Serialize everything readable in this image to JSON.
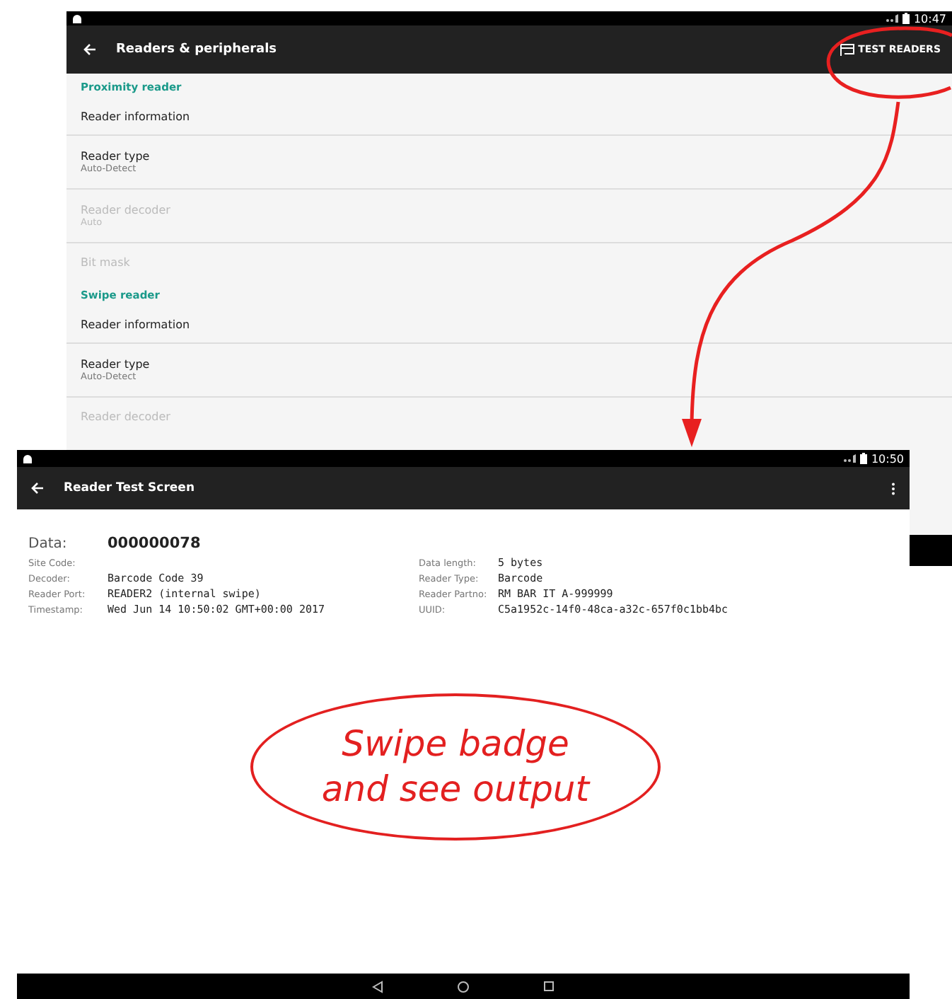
{
  "settings_screen": {
    "status_bar": {
      "time": "10:47"
    },
    "toolbar": {
      "title": "Readers & peripherals",
      "action": "TEST READERS"
    },
    "items": [
      {
        "kind": "header",
        "label": "Proximity reader"
      },
      {
        "kind": "item",
        "label": "Reader information",
        "disabled": false
      },
      {
        "kind": "item",
        "label": "Reader type",
        "summary": "Auto-Detect",
        "disabled": false
      },
      {
        "kind": "item",
        "label": "Reader decoder",
        "summary": "Auto",
        "disabled": true
      },
      {
        "kind": "item",
        "label": "Bit mask",
        "disabled": true
      },
      {
        "kind": "header",
        "label": "Swipe reader"
      },
      {
        "kind": "item",
        "label": "Reader information",
        "disabled": false
      },
      {
        "kind": "item",
        "label": "Reader type",
        "summary": "Auto-Detect",
        "disabled": false
      },
      {
        "kind": "item",
        "label": "Reader decoder",
        "disabled": true
      }
    ]
  },
  "test_screen": {
    "status_bar": {
      "time": "10:50"
    },
    "toolbar": {
      "title": "Reader Test Screen"
    },
    "data_label": "Data:",
    "data_value": "000000078",
    "fields_left": [
      {
        "label": "Site Code:"
      },
      {
        "label": "Decoder:",
        "value": "Barcode Code 39"
      },
      {
        "label": "Reader Port:",
        "value": "READER2 (internal swipe)"
      },
      {
        "label": "Timestamp:",
        "value": "Wed Jun 14 10:50:02 GMT+00:00 2017"
      }
    ],
    "fields_right": [
      {
        "label": "Data length:",
        "value": "5 bytes"
      },
      {
        "label": "Reader Type:",
        "value": "Barcode"
      },
      {
        "label": "Reader Partno:",
        "value": "RM BAR IT A-999999"
      },
      {
        "label": "UUID:",
        "value": "C5a1952c-14f0-48ca-a32c-657f0c1bb4bc"
      }
    ]
  },
  "callout": {
    "lines": [
      "Swipe badge",
      "and see output"
    ]
  }
}
